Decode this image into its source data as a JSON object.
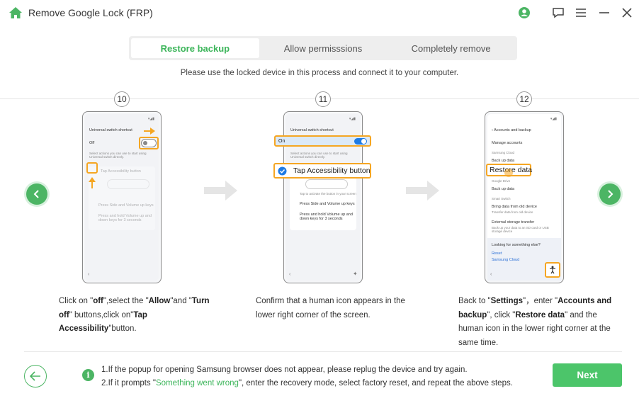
{
  "app": {
    "title": "Remove Google Lock (FRP)"
  },
  "tabs": [
    {
      "label": "Restore backup",
      "active": true
    },
    {
      "label": "Allow permisssions",
      "active": false
    },
    {
      "label": "Completely remove",
      "active": false
    }
  ],
  "subtitle": "Please use the locked device in this process and connect it to your computer.",
  "steps": [
    {
      "number": "10",
      "phone": {
        "header": "Universal switch shortcut",
        "toggle_label": "Off",
        "hint": "Select actions you can use to start using Universal switch directly.",
        "option1": "Tap Accessibility button",
        "option2": "Press Side and Volume up keys",
        "option3": "Press and hold Volume up and down keys for 3 seconds"
      },
      "desc": {
        "p1": "Click on \"",
        "b1": "off",
        "p2": "\",select the \"",
        "b2": "Allow",
        "p3": "\"and \"",
        "b3": "Turn off",
        "p4": "\" buttons,click on\"",
        "b4": "Tap Accessibility",
        "p5": "\"button."
      }
    },
    {
      "number": "11",
      "phone": {
        "header": "Universal switch shortcut",
        "on_label": "On",
        "hint": "Select actions you can use to start using Universal switch directly.",
        "callout": "Tap Accessibility button",
        "option2": "Press Side and Volume up keys",
        "option3": "Press and hold Volume up and down keys for 3 seconds",
        "caption": "Tap  to activate the button in your screen"
      },
      "desc": {
        "text": "Confirm that a human icon appears in the lower right corner of the screen."
      }
    },
    {
      "number": "12",
      "phone": {
        "header": "Accounts and backup",
        "item1": "Manage accounts",
        "sec1": "Samsung Cloud",
        "item2": "Back up data",
        "callout": "Restore data",
        "sec2": "Google Drive",
        "item3": "Back up data",
        "sec3": "Smart Switch",
        "item4": "Bring data from old device",
        "item4_sub": "Transfer data from old device",
        "item5": "External storage transfer",
        "item5_sub": "Back up your data to an SD card or USB storage device",
        "looking": "Looking for something else?",
        "link1": "Reset",
        "link2": "Samsung Cloud"
      },
      "desc": {
        "p1": "Back to \"",
        "b1": "Settings",
        "p2": "\"，enter \"",
        "b2": "Accounts and backup",
        "p3": "\", click \"",
        "b3": "Restore data",
        "p4": "\" and the human icon in the lower right corner at the same time."
      }
    }
  ],
  "notes": {
    "line1": "1.If the popup for opening Samsung browser does not appear, please replug the device and try again.",
    "line2_pre": "2.If it prompts \"",
    "line2_highlight": "Something went wrong",
    "line2_post": "\", enter the recovery mode, select factory reset, and repeat the above steps."
  },
  "buttons": {
    "next": "Next"
  },
  "colors": {
    "accent": "#4cb564",
    "highlight": "#f5a623",
    "text_accent": "#3cb55a"
  },
  "icons": [
    "home-icon",
    "account-icon",
    "feedback-icon",
    "menu-icon",
    "minimize-icon",
    "close-icon",
    "prev-arrow-icon",
    "next-arrow-icon",
    "back-arrow-icon",
    "info-icon"
  ]
}
